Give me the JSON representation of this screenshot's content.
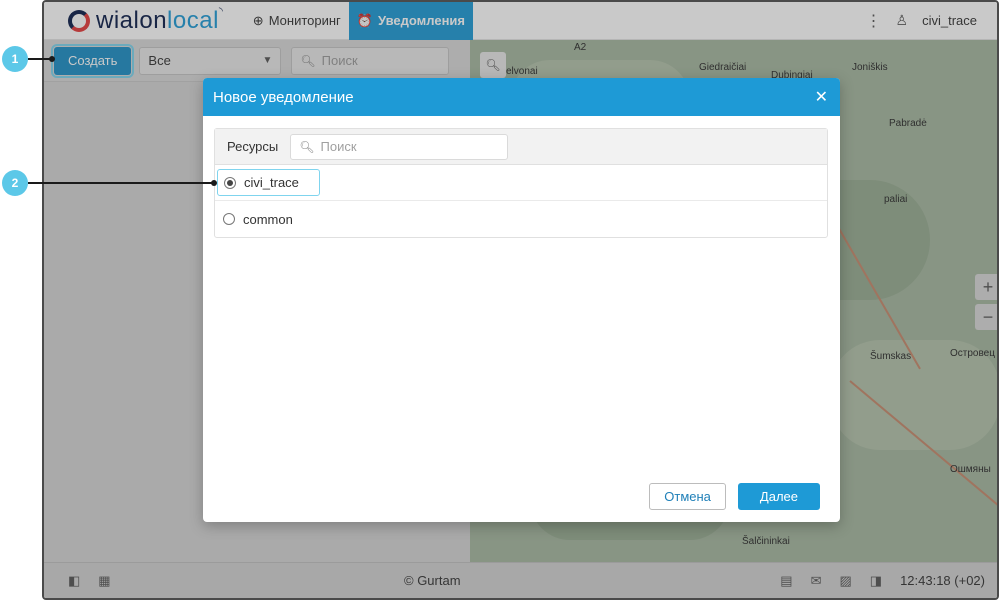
{
  "header": {
    "logo_main": "wialon",
    "logo_local": "local",
    "nav": [
      {
        "label": "Мониторинг",
        "icon": "globe-icon"
      },
      {
        "label": "Уведомления",
        "icon": "alarm-icon",
        "active": true
      }
    ],
    "user": "civi_trace"
  },
  "toolbar": {
    "create_label": "Создать",
    "filter_value": "Все",
    "search_placeholder": "Поиск"
  },
  "map": {
    "labels": [
      "A2",
      "elvonai",
      "Giedraičiai",
      "Dubingiai",
      "Joniškis",
      "Pabradė",
      "paliai",
      "Šumskas",
      "Островец",
      "Ошмяны",
      "Šalčininkai"
    ],
    "zoom_in": "+",
    "zoom_out": "−"
  },
  "modal": {
    "title": "Новое уведомление",
    "resources_label": "Ресурсы",
    "search_placeholder": "Поиск",
    "resources": [
      {
        "name": "civi_trace",
        "selected": true
      },
      {
        "name": "common",
        "selected": false
      }
    ],
    "cancel_label": "Отмена",
    "next_label": "Далее"
  },
  "footer": {
    "copyright": "© Gurtam",
    "time": "12:43:18 (+02)"
  },
  "callouts": [
    "1",
    "2"
  ],
  "colors": {
    "accent": "#1e9ad6",
    "callout": "#5cc8e8"
  }
}
